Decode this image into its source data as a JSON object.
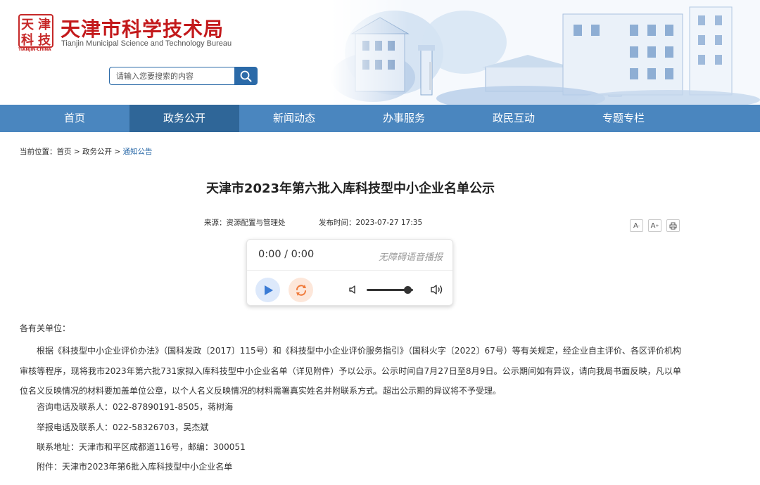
{
  "site": {
    "seal_glyphs": [
      "天",
      "津",
      "科",
      "技"
    ],
    "seal_caption": "TIANJIN·CHINA",
    "title": "天津市科学技术局",
    "subtitle": "Tianjin Municipal Science and Technology Bureau"
  },
  "search": {
    "placeholder": "请输入您要搜索的内容",
    "icon": "search-icon"
  },
  "nav": {
    "items": [
      {
        "label": "首页",
        "active": false
      },
      {
        "label": "政务公开",
        "active": true
      },
      {
        "label": "新闻动态",
        "active": false
      },
      {
        "label": "办事服务",
        "active": false
      },
      {
        "label": "政民互动",
        "active": false
      },
      {
        "label": "专题专栏",
        "active": false
      }
    ]
  },
  "breadcrumb": {
    "prefix": "当前位置：",
    "items": [
      "首页",
      "政务公开",
      "通知公告"
    ],
    "separator": " > "
  },
  "article": {
    "title": "天津市2023年第六批入库科技型中小企业名单公示",
    "source_label": "来源：",
    "source": "资源配置与管理处",
    "time_label": "发布时间：",
    "time": "2023-07-27 17:35",
    "tools": {
      "font_decrease": "A",
      "font_decrease_sign": "-",
      "font_increase": "A",
      "font_increase_sign": "+",
      "print_icon": "print-icon"
    }
  },
  "player": {
    "time": "0:00 / 0:00",
    "label": "无障碍语音播报",
    "volume_level": 0.88,
    "icons": [
      "play-icon",
      "loop-icon",
      "volume-low-icon",
      "volume-high-icon"
    ]
  },
  "content": {
    "salutation": "各有关单位：",
    "paragraph": "根据《科技型中小企业评价办法》（国科发政〔2017〕115号）和《科技型中小企业评价服务指引》（国科火字〔2022〕67号）等有关规定，经企业自主评价、各区评价机构审核等程序，现将我市2023年第六批731家拟入库科技型中小企业名单（详见附件）予以公示。公示时间自7月27日至8月9日。公示期间如有异议，请向我局书面反映，凡以单位名义反映情况的材料要加盖单位公章，以个人名义反映情况的材料需署真实姓名并附联系方式。超出公示期的异议将不予受理。",
    "consult": "咨询电话及联系人：022-87890191-8505，蒋树海",
    "report": "举报电话及联系人：022-58326703，吴杰斌",
    "address": "联系地址：天津市和平区成都道116号，邮编：300051",
    "attachment_label": "附件：",
    "attachment": "天津市2023年第6批入库科技型中小企业名单"
  },
  "colors": {
    "brand_red": "#c3191b",
    "nav_blue": "#4a86bf",
    "nav_active": "#2f6698",
    "link_blue": "#2b6aa8"
  }
}
